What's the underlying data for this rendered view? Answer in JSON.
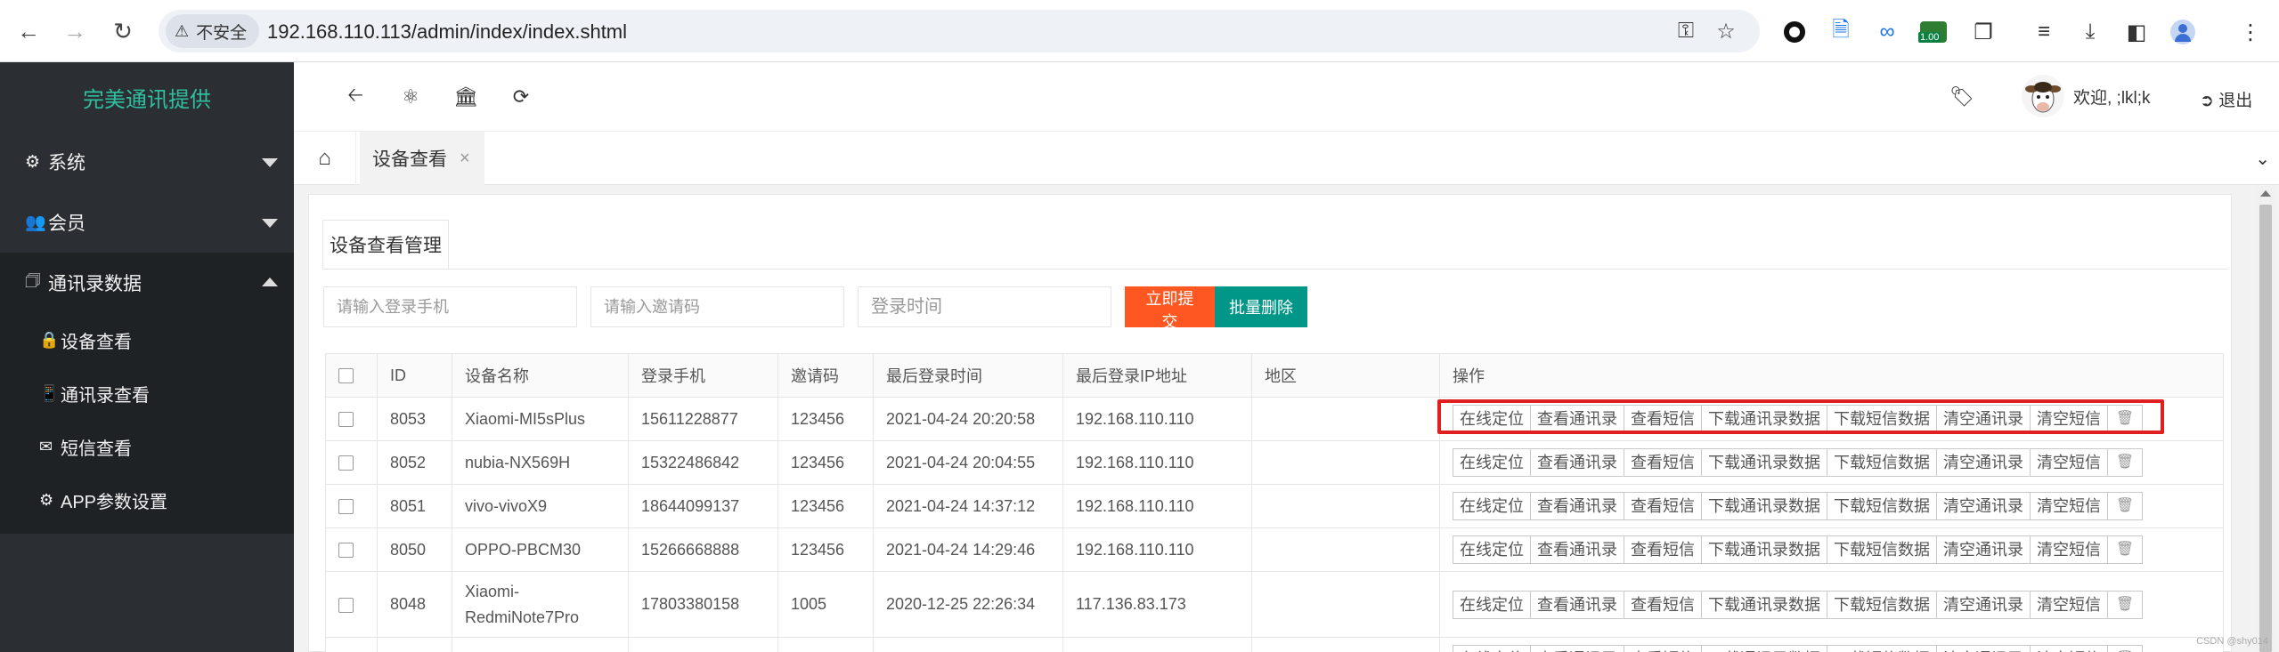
{
  "browser": {
    "security_label": "不安全",
    "url": "192.168.110.113/admin/index/index.shtml",
    "extension_badge": "1.00"
  },
  "sidebar": {
    "brand": "完美通讯提供",
    "menus": [
      {
        "label": "系统",
        "icon": "gear-icon",
        "expanded": false
      },
      {
        "label": "会员",
        "icon": "users-icon",
        "expanded": false
      },
      {
        "label": "通讯录数据",
        "icon": "id-card-icon",
        "expanded": true
      }
    ],
    "submenu": [
      {
        "label": "设备查看",
        "icon": "lock-icon"
      },
      {
        "label": "通讯录查看",
        "icon": "phone-icon"
      },
      {
        "label": "短信查看",
        "icon": "envelope-icon"
      },
      {
        "label": "APP参数设置",
        "icon": "gear-icon"
      }
    ]
  },
  "header": {
    "welcome": "欢迎, ;lkl;k",
    "logout": "退出"
  },
  "tabs": {
    "active_tab": "设备查看"
  },
  "panel": {
    "title": "设备查看管理",
    "search": {
      "phone_placeholder": "请输入登录手机",
      "invite_placeholder": "请输入邀请码",
      "time_placeholder": "登录时间"
    },
    "submit_label": "立即提交",
    "batch_delete_label": "批量删除"
  },
  "table": {
    "headers": [
      "ID",
      "设备名称",
      "登录手机",
      "邀请码",
      "最后登录时间",
      "最后登录IP地址",
      "地区",
      "操作"
    ],
    "actions": [
      "在线定位",
      "查看通讯录",
      "查看短信",
      "下载通讯录数据",
      "下载短信数据",
      "清空通讯录",
      "清空短信"
    ],
    "rows": [
      {
        "id": "8053",
        "device": "Xiaomi-MI5sPlus",
        "phone": "15611228877",
        "invite": "123456",
        "time": "2021-04-24 20:20:58",
        "ip": "192.168.110.110",
        "region": ""
      },
      {
        "id": "8052",
        "device": "nubia-NX569H",
        "phone": "15322486842",
        "invite": "123456",
        "time": "2021-04-24 20:04:55",
        "ip": "192.168.110.110",
        "region": ""
      },
      {
        "id": "8051",
        "device": "vivo-vivoX9",
        "phone": "18644099137",
        "invite": "123456",
        "time": "2021-04-24 14:37:12",
        "ip": "192.168.110.110",
        "region": ""
      },
      {
        "id": "8050",
        "device": "OPPO-PBCM30",
        "phone": "15266668888",
        "invite": "123456",
        "time": "2021-04-24 14:29:46",
        "ip": "192.168.110.110",
        "region": ""
      },
      {
        "id": "8048",
        "device_line1": "Xiaomi-",
        "device_line2": "RedmiNote7Pro",
        "phone": "17803380158",
        "invite": "1005",
        "time": "2020-12-25 22:26:34",
        "ip": "117.136.83.173",
        "region": ""
      }
    ]
  },
  "watermark": "CSDN @shy014",
  "colors": {
    "sidebar_bg": "#2b2f33",
    "brand": "#2fbf9f",
    "submit": "#ff5722",
    "batch_delete": "#009688",
    "highlight": "#e02020"
  }
}
